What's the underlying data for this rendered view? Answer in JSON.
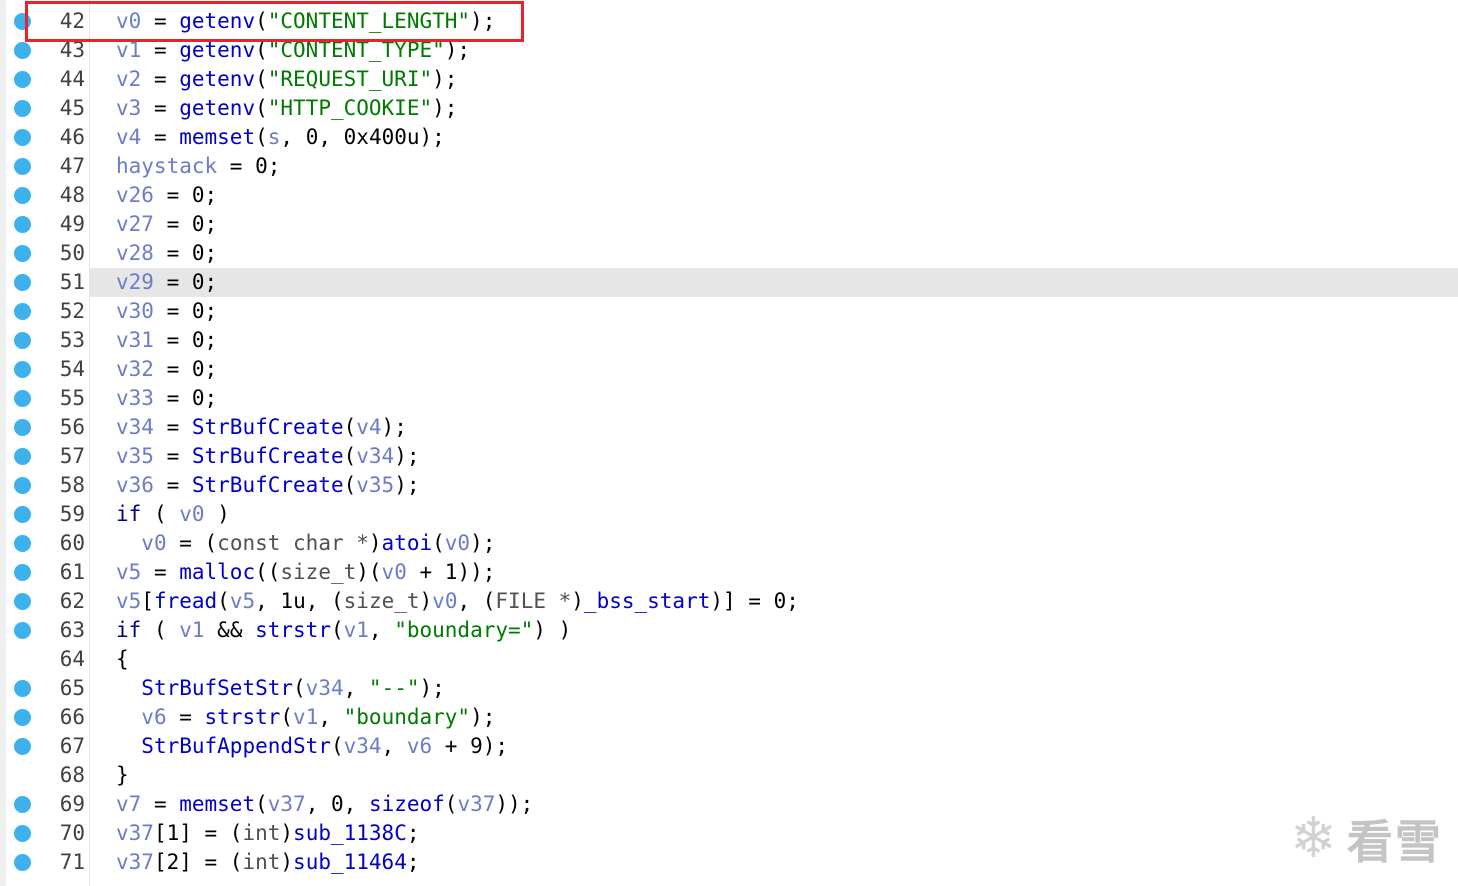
{
  "lines": [
    {
      "no": "42",
      "bp": true,
      "tokens": [
        [
          "var",
          "v0"
        ],
        [
          "op",
          " = "
        ],
        [
          "fn",
          "getenv"
        ],
        [
          "op",
          "("
        ],
        [
          "str",
          "\"CONTENT_LENGTH\""
        ],
        [
          "op",
          ");"
        ]
      ]
    },
    {
      "no": "43",
      "bp": true,
      "tokens": [
        [
          "var",
          "v1"
        ],
        [
          "op",
          " = "
        ],
        [
          "fn",
          "getenv"
        ],
        [
          "op",
          "("
        ],
        [
          "str",
          "\"CONTENT_TYPE\""
        ],
        [
          "op",
          ");"
        ]
      ]
    },
    {
      "no": "44",
      "bp": true,
      "tokens": [
        [
          "var",
          "v2"
        ],
        [
          "op",
          " = "
        ],
        [
          "fn",
          "getenv"
        ],
        [
          "op",
          "("
        ],
        [
          "str",
          "\"REQUEST_URI\""
        ],
        [
          "op",
          ");"
        ]
      ]
    },
    {
      "no": "45",
      "bp": true,
      "tokens": [
        [
          "var",
          "v3"
        ],
        [
          "op",
          " = "
        ],
        [
          "fn",
          "getenv"
        ],
        [
          "op",
          "("
        ],
        [
          "str",
          "\"HTTP_COOKIE\""
        ],
        [
          "op",
          ");"
        ]
      ]
    },
    {
      "no": "46",
      "bp": true,
      "tokens": [
        [
          "var",
          "v4"
        ],
        [
          "op",
          " = "
        ],
        [
          "fn",
          "memset"
        ],
        [
          "op",
          "("
        ],
        [
          "var",
          "s"
        ],
        [
          "op",
          ", "
        ],
        [
          "num",
          "0"
        ],
        [
          "op",
          ", "
        ],
        [
          "num",
          "0x400u"
        ],
        [
          "op",
          ");"
        ]
      ]
    },
    {
      "no": "47",
      "bp": true,
      "tokens": [
        [
          "var",
          "haystack"
        ],
        [
          "op",
          " = "
        ],
        [
          "num",
          "0"
        ],
        [
          "op",
          ";"
        ]
      ]
    },
    {
      "no": "48",
      "bp": true,
      "tokens": [
        [
          "var",
          "v26"
        ],
        [
          "op",
          " = "
        ],
        [
          "num",
          "0"
        ],
        [
          "op",
          ";"
        ]
      ]
    },
    {
      "no": "49",
      "bp": true,
      "tokens": [
        [
          "var",
          "v27"
        ],
        [
          "op",
          " = "
        ],
        [
          "num",
          "0"
        ],
        [
          "op",
          ";"
        ]
      ]
    },
    {
      "no": "50",
      "bp": true,
      "tokens": [
        [
          "var",
          "v28"
        ],
        [
          "op",
          " = "
        ],
        [
          "num",
          "0"
        ],
        [
          "op",
          ";"
        ]
      ]
    },
    {
      "no": "51",
      "bp": true,
      "hl": true,
      "tokens": [
        [
          "var",
          "v29"
        ],
        [
          "op",
          " = "
        ],
        [
          "num",
          "0"
        ],
        [
          "op",
          ";"
        ]
      ]
    },
    {
      "no": "52",
      "bp": true,
      "tokens": [
        [
          "var",
          "v30"
        ],
        [
          "op",
          " = "
        ],
        [
          "num",
          "0"
        ],
        [
          "op",
          ";"
        ]
      ]
    },
    {
      "no": "53",
      "bp": true,
      "tokens": [
        [
          "var",
          "v31"
        ],
        [
          "op",
          " = "
        ],
        [
          "num",
          "0"
        ],
        [
          "op",
          ";"
        ]
      ]
    },
    {
      "no": "54",
      "bp": true,
      "tokens": [
        [
          "var",
          "v32"
        ],
        [
          "op",
          " = "
        ],
        [
          "num",
          "0"
        ],
        [
          "op",
          ";"
        ]
      ]
    },
    {
      "no": "55",
      "bp": true,
      "tokens": [
        [
          "var",
          "v33"
        ],
        [
          "op",
          " = "
        ],
        [
          "num",
          "0"
        ],
        [
          "op",
          ";"
        ]
      ]
    },
    {
      "no": "56",
      "bp": true,
      "tokens": [
        [
          "var",
          "v34"
        ],
        [
          "op",
          " = "
        ],
        [
          "fn",
          "StrBufCreate"
        ],
        [
          "op",
          "("
        ],
        [
          "var",
          "v4"
        ],
        [
          "op",
          ");"
        ]
      ]
    },
    {
      "no": "57",
      "bp": true,
      "tokens": [
        [
          "var",
          "v35"
        ],
        [
          "op",
          " = "
        ],
        [
          "fn",
          "StrBufCreate"
        ],
        [
          "op",
          "("
        ],
        [
          "var",
          "v34"
        ],
        [
          "op",
          ");"
        ]
      ]
    },
    {
      "no": "58",
      "bp": true,
      "tokens": [
        [
          "var",
          "v36"
        ],
        [
          "op",
          " = "
        ],
        [
          "fn",
          "StrBufCreate"
        ],
        [
          "op",
          "("
        ],
        [
          "var",
          "v35"
        ],
        [
          "op",
          ");"
        ]
      ]
    },
    {
      "no": "59",
      "bp": true,
      "tokens": [
        [
          "kw",
          "if"
        ],
        [
          "op",
          " ( "
        ],
        [
          "var",
          "v0"
        ],
        [
          "op",
          " )"
        ]
      ]
    },
    {
      "no": "60",
      "bp": true,
      "tokens": [
        [
          "op",
          "  "
        ],
        [
          "var",
          "v0"
        ],
        [
          "op",
          " = ("
        ],
        [
          "ty",
          "const char *"
        ],
        [
          "op",
          ")"
        ],
        [
          "fn",
          "atoi"
        ],
        [
          "op",
          "("
        ],
        [
          "var",
          "v0"
        ],
        [
          "op",
          ");"
        ]
      ]
    },
    {
      "no": "61",
      "bp": true,
      "tokens": [
        [
          "var",
          "v5"
        ],
        [
          "op",
          " = "
        ],
        [
          "fn",
          "malloc"
        ],
        [
          "op",
          "(("
        ],
        [
          "ty",
          "size_t"
        ],
        [
          "op",
          ")("
        ],
        [
          "var",
          "v0"
        ],
        [
          "op",
          " + "
        ],
        [
          "num",
          "1"
        ],
        [
          "op",
          "));"
        ]
      ]
    },
    {
      "no": "62",
      "bp": true,
      "tokens": [
        [
          "var",
          "v5"
        ],
        [
          "op",
          "["
        ],
        [
          "fn",
          "fread"
        ],
        [
          "op",
          "("
        ],
        [
          "var",
          "v5"
        ],
        [
          "op",
          ", "
        ],
        [
          "num",
          "1u"
        ],
        [
          "op",
          ", ("
        ],
        [
          "ty",
          "size_t"
        ],
        [
          "op",
          ")"
        ],
        [
          "var",
          "v0"
        ],
        [
          "op",
          ", ("
        ],
        [
          "ty",
          "FILE *"
        ],
        [
          "op",
          ")"
        ],
        [
          "fn",
          "_bss_start"
        ],
        [
          "op",
          ")] = "
        ],
        [
          "num",
          "0"
        ],
        [
          "op",
          ";"
        ]
      ]
    },
    {
      "no": "63",
      "bp": true,
      "tokens": [
        [
          "kw",
          "if"
        ],
        [
          "op",
          " ( "
        ],
        [
          "var",
          "v1"
        ],
        [
          "op",
          " && "
        ],
        [
          "fn",
          "strstr"
        ],
        [
          "op",
          "("
        ],
        [
          "var",
          "v1"
        ],
        [
          "op",
          ", "
        ],
        [
          "str",
          "\"boundary=\""
        ],
        [
          "op",
          ") )"
        ]
      ]
    },
    {
      "no": "64",
      "bp": false,
      "tokens": [
        [
          "op",
          "{"
        ]
      ]
    },
    {
      "no": "65",
      "bp": true,
      "tokens": [
        [
          "op",
          "  "
        ],
        [
          "fn",
          "StrBufSetStr"
        ],
        [
          "op",
          "("
        ],
        [
          "var",
          "v34"
        ],
        [
          "op",
          ", "
        ],
        [
          "str",
          "\"--\""
        ],
        [
          "op",
          ");"
        ]
      ]
    },
    {
      "no": "66",
      "bp": true,
      "tokens": [
        [
          "op",
          "  "
        ],
        [
          "var",
          "v6"
        ],
        [
          "op",
          " = "
        ],
        [
          "fn",
          "strstr"
        ],
        [
          "op",
          "("
        ],
        [
          "var",
          "v1"
        ],
        [
          "op",
          ", "
        ],
        [
          "str",
          "\"boundary\""
        ],
        [
          "op",
          ");"
        ]
      ]
    },
    {
      "no": "67",
      "bp": true,
      "tokens": [
        [
          "op",
          "  "
        ],
        [
          "fn",
          "StrBufAppendStr"
        ],
        [
          "op",
          "("
        ],
        [
          "var",
          "v34"
        ],
        [
          "op",
          ", "
        ],
        [
          "var",
          "v6"
        ],
        [
          "op",
          " + "
        ],
        [
          "num",
          "9"
        ],
        [
          "op",
          ");"
        ]
      ]
    },
    {
      "no": "68",
      "bp": false,
      "tokens": [
        [
          "op",
          "}"
        ]
      ]
    },
    {
      "no": "69",
      "bp": true,
      "tokens": [
        [
          "var",
          "v7"
        ],
        [
          "op",
          " = "
        ],
        [
          "fn",
          "memset"
        ],
        [
          "op",
          "("
        ],
        [
          "var",
          "v37"
        ],
        [
          "op",
          ", "
        ],
        [
          "num",
          "0"
        ],
        [
          "op",
          ", "
        ],
        [
          "fn",
          "sizeof"
        ],
        [
          "op",
          "("
        ],
        [
          "var",
          "v37"
        ],
        [
          "op",
          "));"
        ]
      ]
    },
    {
      "no": "70",
      "bp": true,
      "tokens": [
        [
          "var",
          "v37"
        ],
        [
          "op",
          "[1] = ("
        ],
        [
          "ty",
          "int"
        ],
        [
          "op",
          ")"
        ],
        [
          "fn",
          "sub_1138C"
        ],
        [
          "op",
          ";"
        ]
      ]
    },
    {
      "no": "71",
      "bp": true,
      "tokens": [
        [
          "var",
          "v37"
        ],
        [
          "op",
          "[2] = ("
        ],
        [
          "ty",
          "int"
        ],
        [
          "op",
          ")"
        ],
        [
          "fn",
          "sub_11464"
        ],
        [
          "op",
          ";"
        ]
      ]
    }
  ],
  "colors": {
    "variable": "#6c7cc7",
    "function": "#0000c8",
    "string": "#007a00",
    "highlight": "#e6e6e6",
    "breakpoint": "#3db1ec",
    "callout_box": "#e8232c"
  },
  "watermark": {
    "icon": "snowflake-icon",
    "text": "看雪"
  }
}
